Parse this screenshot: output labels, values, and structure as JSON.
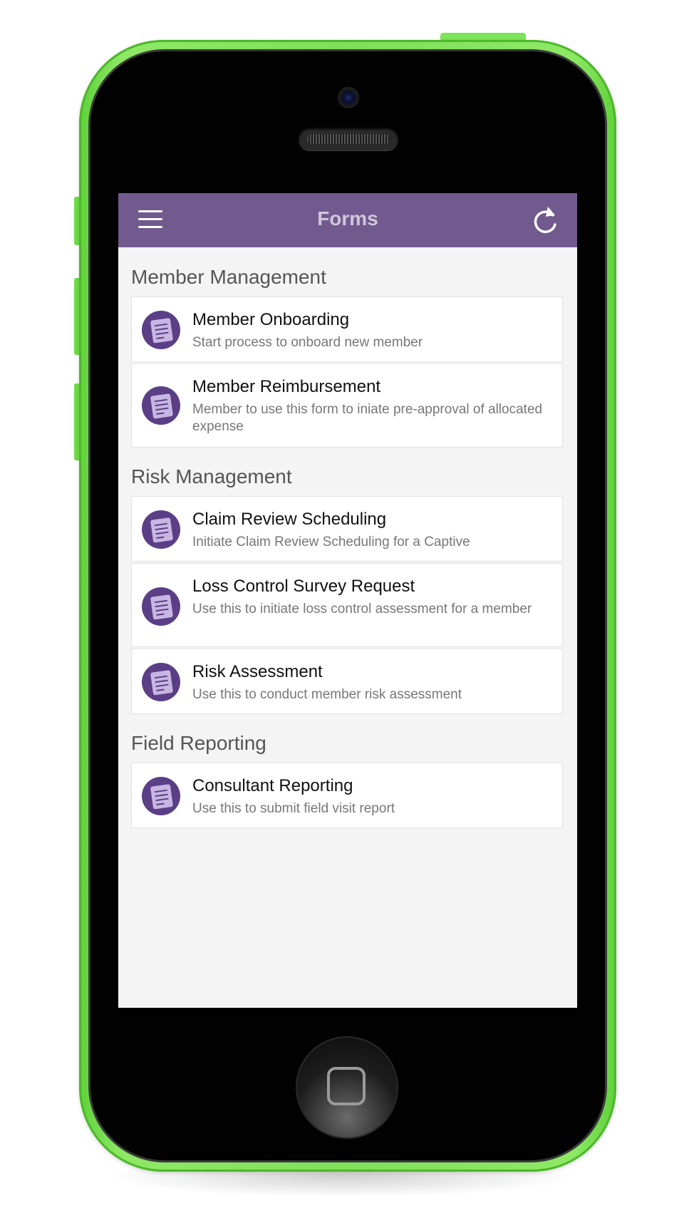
{
  "header": {
    "title": "Forms"
  },
  "sections": [
    {
      "title": "Member Management",
      "items": [
        {
          "title": "Member Onboarding",
          "subtitle": "Start process to onboard new member"
        },
        {
          "title": "Member Reimbursement",
          "subtitle": "Member to use this form to iniate pre-approval of allocated expense"
        }
      ]
    },
    {
      "title": "Risk Management",
      "items": [
        {
          "title": "Claim Review Scheduling",
          "subtitle": "Initiate Claim Review Scheduling for a Captive"
        },
        {
          "title": "Loss Control Survey Request",
          "subtitle": "Use this to initiate loss control assessment for a member"
        },
        {
          "title": "Risk Assessment",
          "subtitle": "Use this to conduct member risk assessment"
        }
      ]
    },
    {
      "title": "Field Reporting",
      "items": [
        {
          "title": "Consultant Reporting",
          "subtitle": "Use this to submit field visit report"
        }
      ]
    }
  ],
  "colors": {
    "header_bg": "#715a8e",
    "phone_body": "#7fe05a",
    "icon_bg": "#5a3f86",
    "icon_page": "#c8b6e2"
  },
  "icons": {
    "menu": "hamburger-icon",
    "refresh": "refresh-icon",
    "form": "form-document-icon"
  }
}
